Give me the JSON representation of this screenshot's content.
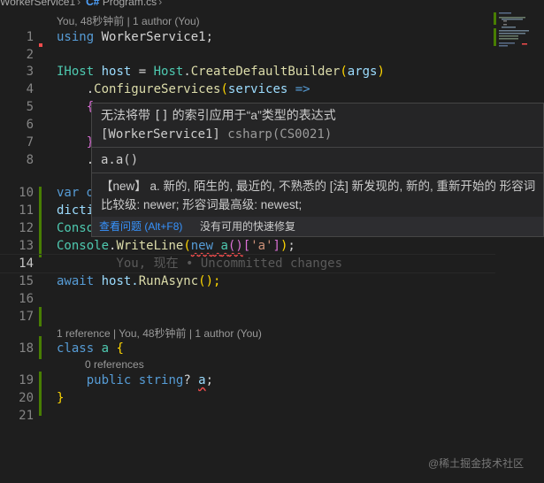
{
  "breadcrumb": {
    "project": "WorkerService1",
    "lang_icon": "C#",
    "file": "Program.cs"
  },
  "lenses": {
    "top": "You, 48秒钟前 | 1 author (You)",
    "class_a": "1 reference | You, 48秒钟前 | 1 author (You)",
    "class_a_refs": "0 references"
  },
  "lines": [
    {
      "n": "1"
    },
    {
      "n": "2"
    },
    {
      "n": "3"
    },
    {
      "n": "4"
    },
    {
      "n": "5"
    },
    {
      "n": "6"
    },
    {
      "n": "7"
    },
    {
      "n": "8"
    },
    {
      "n": "10"
    },
    {
      "n": "11"
    },
    {
      "n": "12"
    },
    {
      "n": "13"
    },
    {
      "n": "14"
    },
    {
      "n": "15"
    },
    {
      "n": "16"
    },
    {
      "n": "17"
    },
    {
      "n": "18"
    },
    {
      "n": "19"
    },
    {
      "n": "20"
    },
    {
      "n": "21"
    }
  ],
  "code": {
    "l1_kw": "using",
    "l1_ns": " WorkerService1;",
    "l3_type": "IHost",
    "l3_var": " host ",
    "l3_eq": "= ",
    "l3_host": "Host",
    "l3_dot": ".",
    "l3_fn": "CreateDefaultBuilder",
    "l3_p1": "(",
    "l3_arg": "args",
    "l3_p2": ")",
    "l4_indent": "    .",
    "l4_fn": "ConfigureServices",
    "l4_p": "(",
    "l4_param": "services",
    "l4_arrow": " =>",
    "l5": "    {",
    "l6": "    ",
    "l7": "    }",
    "l8": "    .",
    "l10": "var d",
    "l11": "dicti",
    "l12": "Conso",
    "l13_type": "Console",
    "l13_dot": ".",
    "l13_fn": "WriteLine",
    "l13_p1": "(",
    "l13_new": "new",
    "l13_sp": " ",
    "l13_a": "a",
    "l13_call": "()",
    "l13_b1": "[",
    "l13_str": "'a'",
    "l13_b2": "]",
    "l13_p2": ")",
    "l13_semi": ";",
    "l14_ghost": "        You, 现在 • Uncommitted changes",
    "l15_kw": "await",
    "l15_rest": " host.",
    "l15_fn": "RunAsync",
    "l15_end": "();",
    "l18_kw": "class",
    "l18_name": " a",
    "l18_brace": " {",
    "l19_indent": "    ",
    "l19_kw": "public",
    "l19_sp": " ",
    "l19_kw2": "string",
    "l19_q": "? ",
    "l19_field": "a",
    "l19_semi": ";",
    "l20": "}"
  },
  "hover": {
    "message_pre": "无法将带 ",
    "message_code": "[]",
    "message_post": " 的索引应用于“a”类型的表达式",
    "context_project": "[WorkerService1]",
    "context_code": " csharp(CS0021)",
    "signature": "a.a()",
    "definition": "【new】 a. 新的, 陌生的, 最近的, 不熟悉的 [法] 新发现的, 新的, 重新开始的 形容词比较级: newer; 形容词最高级: newest;",
    "view_problem": "查看问题",
    "view_problem_kb": " (Alt+F8)",
    "no_fix": "没有可用的快速修复"
  },
  "watermark": "@稀土掘金技术社区",
  "colors": {
    "background": "#1e1e1e",
    "keyword": "#569cd6",
    "type": "#4ec9b0",
    "function": "#dcdcaa",
    "string": "#ce9178",
    "error": "#f14c4c",
    "link": "#3794ff",
    "gutter_added": "#487e02"
  }
}
